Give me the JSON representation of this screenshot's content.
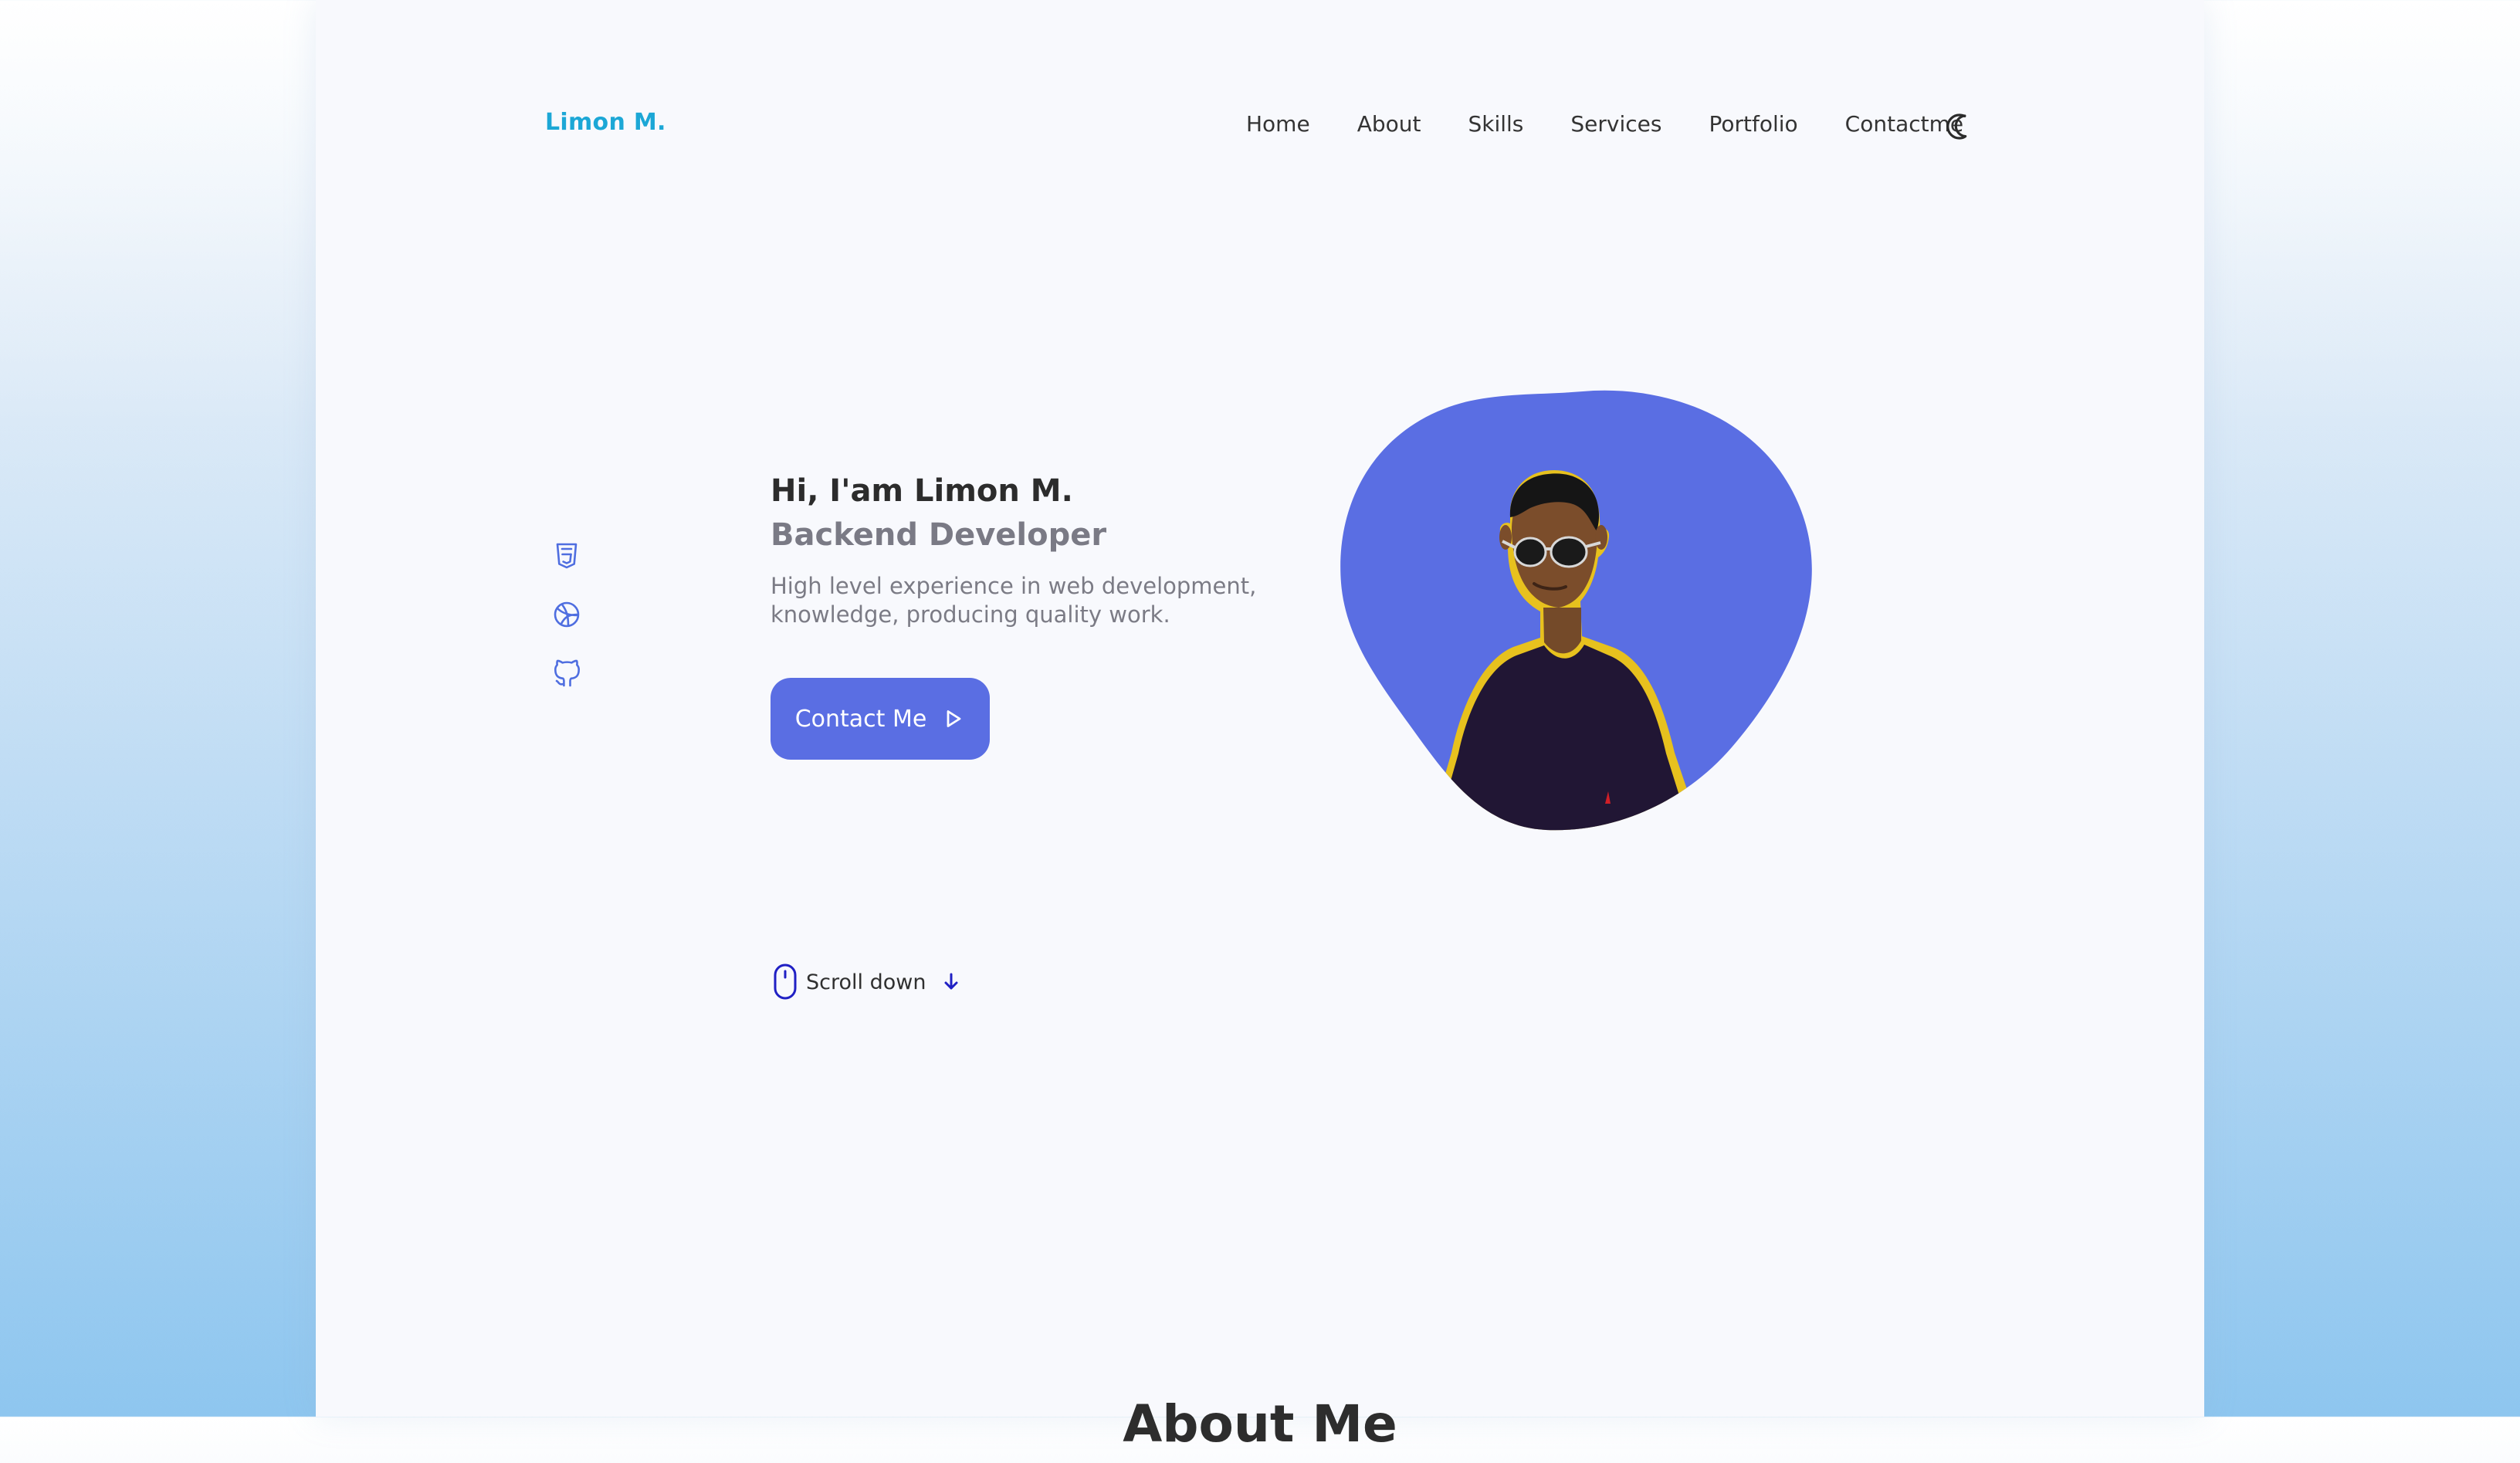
{
  "site": {
    "logo": "Limon M."
  },
  "nav": {
    "items": [
      {
        "label": "Home"
      },
      {
        "label": "About"
      },
      {
        "label": "Skills"
      },
      {
        "label": "Services"
      },
      {
        "label": "Portfolio"
      },
      {
        "label": "Contactme"
      }
    ]
  },
  "hero": {
    "hello": "Hi, I'am Limon M.",
    "role": "Backend Developer",
    "desc": "High level experience in web development, knowledge, producing quality work.",
    "cta": "Contact Me"
  },
  "social": {
    "items": [
      {
        "icon": "html5-icon"
      },
      {
        "icon": "dribbble-icon"
      },
      {
        "icon": "github-icon"
      }
    ]
  },
  "scroll": {
    "label": "Scroll down"
  },
  "about": {
    "title": "About Me"
  },
  "colors": {
    "accent": "#5a6ee3",
    "logo": "#1ca7d6"
  }
}
